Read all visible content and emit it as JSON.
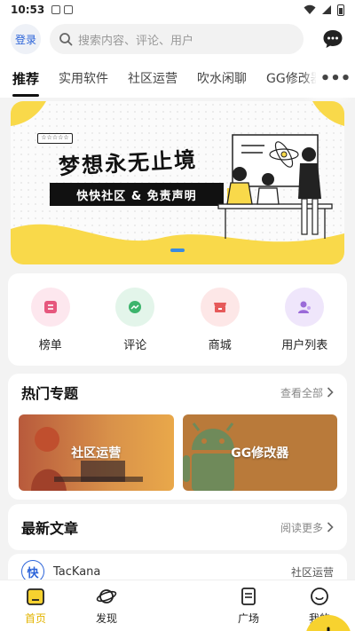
{
  "status_bar": {
    "time": "10:53"
  },
  "header": {
    "login_label": "登录",
    "search_placeholder": "搜索内容、评论、用户"
  },
  "tabs": [
    {
      "label": "推荐",
      "active": true
    },
    {
      "label": "实用软件"
    },
    {
      "label": "社区运营"
    },
    {
      "label": "吹水闲聊"
    },
    {
      "label": "GG修改器"
    }
  ],
  "banner": {
    "tag": "☆☆☆☆☆",
    "title": "梦想永无止境",
    "subtitle": "快快社区 & 免责声明"
  },
  "quick_links": [
    {
      "label": "榜单",
      "icon": "ranking-icon",
      "bg": "#fde7ee",
      "fg": "#e6577d"
    },
    {
      "label": "评论",
      "icon": "comment-icon",
      "bg": "#e3f5ea",
      "fg": "#3cb46c"
    },
    {
      "label": "商城",
      "icon": "shop-icon",
      "bg": "#fde7e7",
      "fg": "#e65a5a"
    },
    {
      "label": "用户列表",
      "icon": "users-icon",
      "bg": "#efe6fb",
      "fg": "#9a6ad8"
    }
  ],
  "hot_topics": {
    "title": "热门专题",
    "more": "查看全部",
    "items": [
      {
        "label": "社区运营"
      },
      {
        "label": "GG修改器"
      }
    ]
  },
  "latest": {
    "title": "最新文章",
    "more": "阅读更多",
    "first_article": {
      "avatar_text": "快",
      "author": "TacKana",
      "category": "社区运营"
    }
  },
  "bottom_nav": [
    {
      "label": "首页",
      "icon": "home-icon",
      "active": true
    },
    {
      "label": "发现",
      "icon": "planet-icon"
    },
    {
      "label": "",
      "icon": "plus-icon"
    },
    {
      "label": "广场",
      "icon": "document-icon"
    },
    {
      "label": "我的",
      "icon": "profile-icon"
    }
  ],
  "colors": {
    "accent": "#f7d22f",
    "login_blue": "#2a62d8"
  }
}
